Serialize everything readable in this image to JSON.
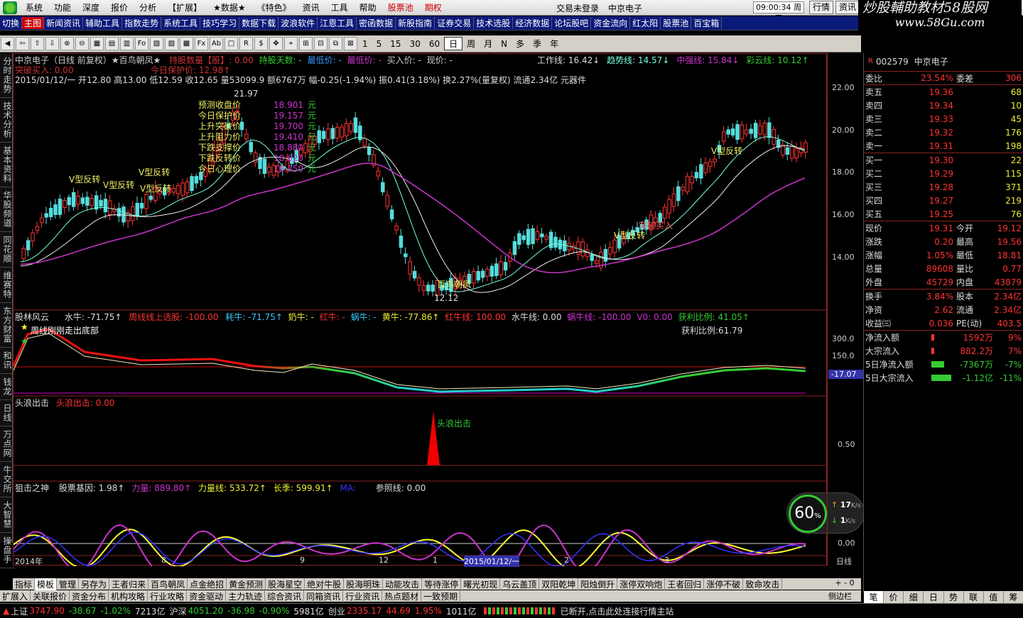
{
  "menu": {
    "items": [
      "系统",
      "功能",
      "深度",
      "报价",
      "分析",
      "【扩展】",
      "★数据★",
      "《特色》",
      "资讯",
      "工具",
      "帮助",
      "股票池",
      "期权"
    ],
    "status": "交易未登录",
    "stock": "中京电子",
    "time": "09:00:34 周三",
    "btn1": "行情",
    "btn2": "资讯"
  },
  "watermark": {
    "line1": "炒股輔助教材58股网",
    "line2": "www.58Gu.com"
  },
  "linkbar": [
    "切换",
    "主图",
    "新闻资讯",
    "辅助工具",
    "指数走势",
    "系统工具",
    "技巧学习",
    "数据下载",
    "波浪软件",
    "江恩工具",
    "密函数据",
    "新股指南",
    "证券交易",
    "技术选股",
    "经济数据",
    "论坛股吧",
    "资金流向",
    "红太阳",
    "股票池",
    "百宝箱"
  ],
  "toolbar": {
    "icons": [
      "◀",
      "⇦",
      "⇧",
      "⇩",
      "⊕",
      "⊖",
      "▦",
      "▤",
      "▥",
      "Fo",
      "▧",
      "▨",
      "▩",
      "Fx",
      "Ab",
      "□",
      "R",
      "$",
      "✥",
      "⌖",
      "⊞",
      "⊟",
      "⧉",
      "⊠"
    ],
    "periods": [
      "1",
      "5",
      "15",
      "30",
      "60",
      "日",
      "周",
      "月",
      "N",
      "多",
      "季",
      "年"
    ]
  },
  "lefttabs": [
    "分时走势",
    "技术分析",
    "基本资料",
    "华股频道",
    "同花顺",
    "维赛特",
    "东方财富",
    "和讯",
    "钱龙",
    "日线",
    "万点网",
    "牛交所",
    "大智慧",
    "操盘手"
  ],
  "main": {
    "title": "中京电子（日线 前复权）★百鸟朝凤★",
    "title2": "持股数量【股】: 0.00",
    "title3": "持股天数: -",
    "title4": "最低价: -",
    "title5": "最低价: -",
    "title6": "买入价: -",
    "title7": "现价: -",
    "work": "工作线: 16.42↓",
    "trend": "趋势线: 14.57↓",
    "mid": "中强线: 15.84↓",
    "rainbow": "彩云线: 10.12↑",
    "buy": "突破买入: 0.00",
    "protect": "今日保护价: 12.98↑",
    "info": "2015/01/12/一 开12.80 高13.00 低12.59 收12.65 量53099.9 额6767万 幅-0.25(-1.94%) 振0.41(3.18%) 换2.27%(量复权) 流通2.34亿 元器件",
    "predict": [
      {
        "label": "预测收盘价",
        "value": "18.901",
        "unit": "元"
      },
      {
        "label": "今日保护价",
        "value": "19.157",
        "unit": "元"
      },
      {
        "label": "上升突破价",
        "value": "19.700",
        "unit": "元"
      },
      {
        "label": "上升阻力价",
        "value": "19.410",
        "unit": "元"
      },
      {
        "label": "下跌支撑价",
        "value": "18.880",
        "unit": "元"
      },
      {
        "label": "下跌反转价",
        "value": "18.620",
        "unit": "元"
      },
      {
        "label": "今日心理价",
        "value": "18.350",
        "unit": "元"
      }
    ],
    "vlabels": [
      "V型反转",
      "V型反转",
      "V型反转",
      "V型反转",
      "V型反转"
    ],
    "high": "21.97",
    "low": "12.12",
    "bird": "百鸟朝凤",
    "breakbuy": "突破买入",
    "vtop": "V型反转"
  },
  "panel2": {
    "title": "股林风云",
    "s1": "水牛: -71.75↑",
    "s2": "周线线上选股: -100.00",
    "s3": "耗牛: -71.75↑",
    "s4": "奶牛: -",
    "s5": "红牛: -",
    "s6": "蜗牛: -",
    "s7": "黄牛: -77.86↑",
    "s8": "红牛线: 100.00",
    "s9": "水牛线: 0.00",
    "s10": "蜗牛线: -100.00",
    "s11": "V0: 0.00",
    "s12": "获利比例: 41.05↑",
    "ratio": "获利比例:61.79",
    "anno": "周线刚刚走出底部",
    "ax1": "300.0",
    "ax2": "150.0",
    "ax3": "-17.07"
  },
  "panel3": {
    "title": "头浪出击",
    "sub": "头浪出击: 0.00",
    "label": "头浪出击",
    "ax": "0.50"
  },
  "panel4": {
    "title": "狙击之神",
    "s1": "股票基因: 1.98↑",
    "s2": "力量: 889.80↑",
    "s3": "力量线: 533.72↑",
    "s4": "长季: 599.91↑",
    "s5": "MA:",
    "s6": "参照线: 0.00",
    "ax": "0.00",
    "pct": "60",
    "pctunit": "%",
    "up": "17",
    "upu": "K/s",
    "down": "1",
    "downu": "K/s"
  },
  "axis": {
    "prices": [
      "22.00",
      "20.00",
      "18.00",
      "16.00",
      "14.00"
    ],
    "dates": [
      "2014年",
      "8",
      "9",
      "12",
      "1",
      "2015/01/12/一",
      "2",
      "3"
    ],
    "period": "日线"
  },
  "right": {
    "code": "002579",
    "name": "中京电子",
    "wb": "委比",
    "wbv": "23.54%",
    "wc": "委差",
    "wcv": "306",
    "sells": [
      {
        "l": "卖五",
        "p": "19.36",
        "v": "68"
      },
      {
        "l": "卖四",
        "p": "19.34",
        "v": "10"
      },
      {
        "l": "卖三",
        "p": "19.33",
        "v": "45"
      },
      {
        "l": "卖二",
        "p": "19.32",
        "v": "176"
      },
      {
        "l": "卖一",
        "p": "19.31",
        "v": "198"
      }
    ],
    "buys": [
      {
        "l": "买一",
        "p": "19.30",
        "v": "22"
      },
      {
        "l": "买二",
        "p": "19.29",
        "v": "115"
      },
      {
        "l": "买三",
        "p": "19.28",
        "v": "371"
      },
      {
        "l": "买四",
        "p": "19.27",
        "v": "219"
      },
      {
        "l": "买五",
        "p": "19.25",
        "v": "76"
      }
    ],
    "quote": [
      [
        "现价",
        "19.31",
        "今开",
        "19.12"
      ],
      [
        "涨跌",
        "0.20",
        "最高",
        "19.56"
      ],
      [
        "涨幅",
        "1.05%",
        "最低",
        "18.81"
      ],
      [
        "总量",
        "89608",
        "量比",
        "0.77"
      ],
      [
        "外盘",
        "45729",
        "内盘",
        "43879"
      ]
    ],
    "fin": [
      [
        "换手",
        "3.84%",
        "股本",
        "2.34亿"
      ],
      [
        "净资",
        "2.62",
        "流通",
        "2.34亿"
      ],
      [
        "收益㈢",
        "0.036",
        "PE(动)",
        "403.5"
      ]
    ],
    "flow": [
      {
        "l": "净流入额",
        "v": "1592万",
        "p": "9%"
      },
      {
        "l": "大宗流入",
        "v": "882.2万",
        "p": "7%"
      },
      {
        "l": "5日净流入额",
        "v": "-7367万",
        "p": "-7%"
      },
      {
        "l": "5日大宗流入",
        "v": "-1.12亿",
        "p": "-11%"
      }
    ],
    "tabs": [
      "笔",
      "价",
      "细",
      "日",
      "势",
      "联",
      "值",
      "筹"
    ]
  },
  "bottomtabs": [
    "指标",
    "模板",
    "管理",
    "另存为",
    "王者归来",
    "百鸟朝凤",
    "点金绝招",
    "黄金预测",
    "股海星空",
    "绝对牛股",
    "股海明珠",
    "动能攻击",
    "等待涨停",
    "曙光初现",
    "乌云盖顶",
    "双阳乾坤",
    "阳烛倒升",
    "涨停双响炮",
    "王者回归",
    "涨停不破",
    "致命攻击"
  ],
  "bottom2": [
    "扩展入",
    "关联报价",
    "资金分布",
    "机构攻略",
    "行业攻略",
    "资金驱动",
    "主力轨迹",
    "综合资讯",
    "同箱资讯",
    "行业资讯",
    "热点题材",
    "一致预期"
  ],
  "bottom2right": "侧边栏",
  "status": {
    "sh": "上证",
    "shv": "3747.90",
    "shc": "-38.67",
    "shp": "-1.02%",
    "sha": "7213亿",
    "hs": "沪深",
    "hsv": "4051.20",
    "hsc": "-36.98",
    "hsp": "-0.90%",
    "hsa": "5981亿",
    "cy": "创业",
    "cyv": "2335.17",
    "cyc": "44.69",
    "cyp": "1.95%",
    "cya": "1011亿",
    "msg": "已断开,点击此处连接行情主站"
  }
}
